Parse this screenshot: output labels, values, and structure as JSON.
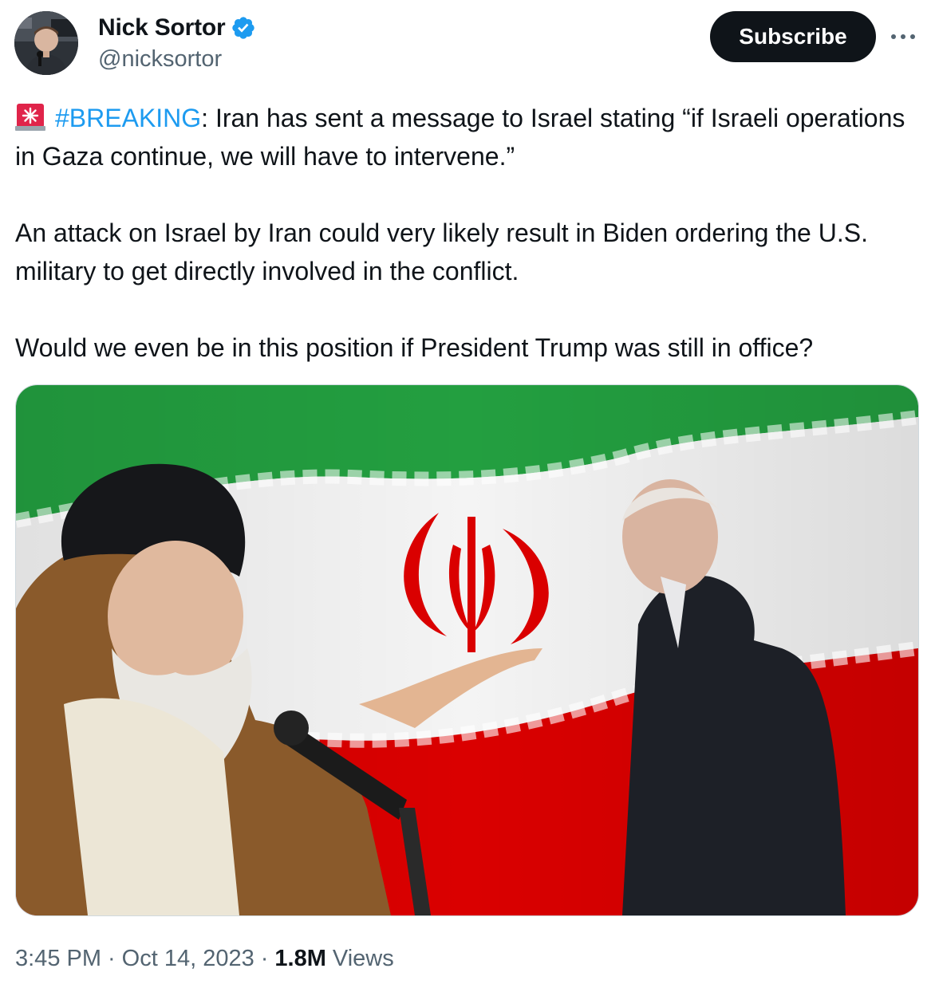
{
  "author": {
    "display_name": "Nick Sortor",
    "handle": "@nicksortor",
    "verified": true,
    "verified_color": "#1d9bf0"
  },
  "subscribe_label": "Subscribe",
  "more_icon": "more-horizontal-icon",
  "tweet": {
    "emoji": "rotating-light-siren-icon",
    "hashtag": "#BREAKING",
    "line1_rest": ": Iran has sent a message to Israel stating “if Israeli operations in Gaza continue, we will have to intervene.”",
    "paragraph2": "An attack on Israel by Iran could very likely result in Biden ordering the U.S. military to get directly involved in the conflict.",
    "paragraph3": "Would we even be in this position if President Trump was still in office?"
  },
  "meta": {
    "time": "3:45 PM",
    "separator": "·",
    "date": "Oct 14, 2023",
    "views_count": "1.8M",
    "views_label": "Views"
  },
  "colors": {
    "hashtag": "#1d9bf0",
    "text": "#0f1419",
    "secondary": "#536471",
    "button": "#0f1419"
  }
}
